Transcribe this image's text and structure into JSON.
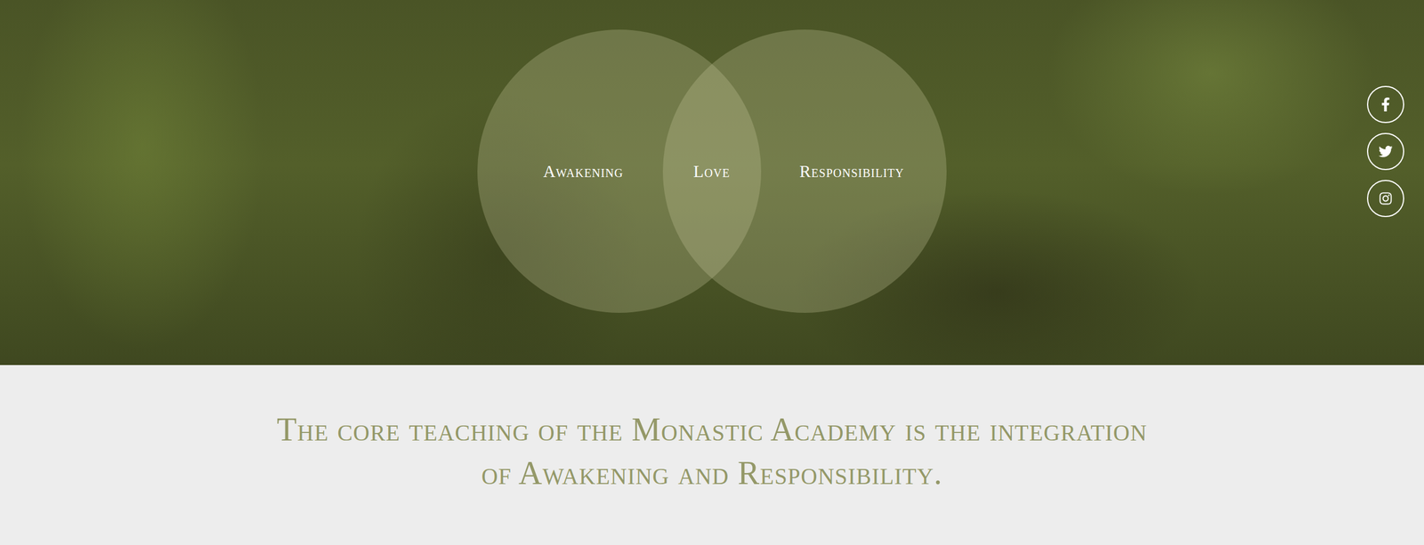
{
  "hero": {
    "venn": [
      {
        "label": "Awakening"
      },
      {
        "label": "Love"
      },
      {
        "label": "Responsibility"
      }
    ]
  },
  "intro": {
    "text": "The core teaching of the Monastic Academy is the integration of Awakening and Responsibility."
  }
}
